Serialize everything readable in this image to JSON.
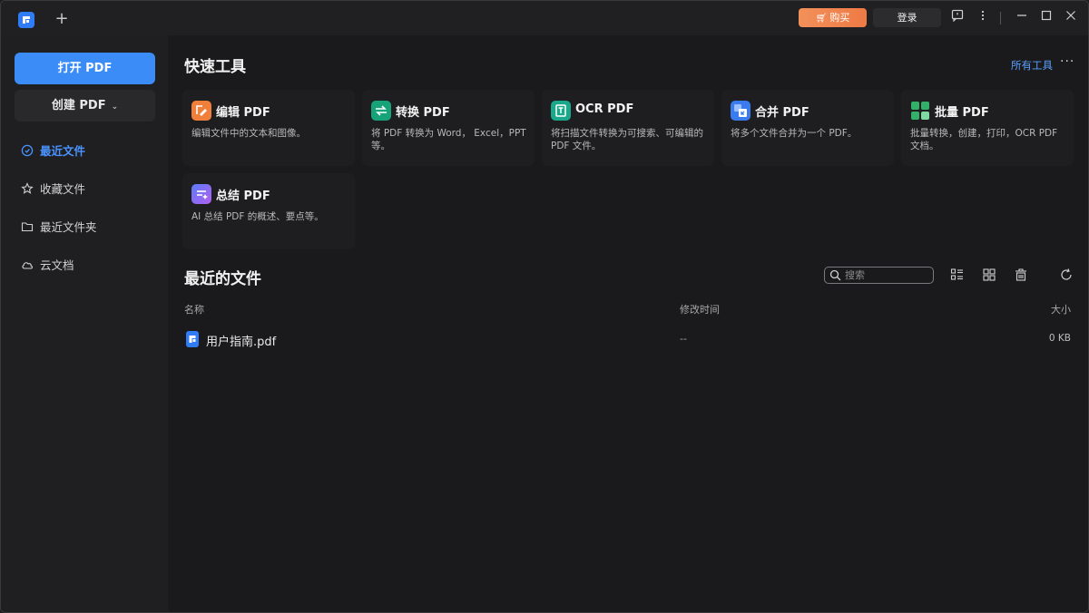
{
  "titlebar": {
    "new_tab": "+",
    "buy_label": "购买",
    "login_label": "登录",
    "icons": [
      "feedback-icon",
      "more-vertical-icon",
      "minimize-icon",
      "maximize-icon",
      "close-icon"
    ]
  },
  "sidebar": {
    "open_pdf": "打开 PDF",
    "create_pdf": "创建 PDF",
    "items": [
      {
        "label": "最近文件",
        "icon": "clock-icon",
        "active": true
      },
      {
        "label": "收藏文件",
        "icon": "star-icon",
        "active": false
      },
      {
        "label": "最近文件夹",
        "icon": "folder-icon",
        "active": false
      },
      {
        "label": "云文档",
        "icon": "cloud-icon",
        "active": false
      }
    ]
  },
  "quick_tools": {
    "title": "快速工具",
    "all_tools": "所有工具",
    "more": "···",
    "tools": [
      {
        "name": "编辑 PDF",
        "desc": "编辑文件中的文本和图像。",
        "color": "#f07f3c"
      },
      {
        "name": "转换 PDF",
        "desc": "将 PDF 转换为 Word， Excel，PPT 等。",
        "color": "#17a37a"
      },
      {
        "name": "OCR PDF",
        "desc": "将扫描文件转换为可搜索、可编辑的 PDF 文件。",
        "color": "#1aa78a"
      },
      {
        "name": "合并 PDF",
        "desc": "将多个文件合并为一个 PDF。",
        "color": "#3b7bf0"
      },
      {
        "name": "批量 PDF",
        "desc": "批量转换，创建，打印，OCR PDF 文档。",
        "color": "#32b06a"
      },
      {
        "name": "总结 PDF",
        "desc": "AI 总结 PDF 的概述、要点等。",
        "color": "#7a5cf0"
      }
    ]
  },
  "recent": {
    "title": "最近的文件",
    "search_placeholder": "搜索",
    "columns": {
      "name": "名称",
      "modified": "修改时间",
      "size": "大小"
    },
    "files": [
      {
        "name": "用户指南.pdf",
        "modified": "--",
        "size": "0 KB"
      }
    ]
  },
  "colors": {
    "accent": "#3b8cf7",
    "buy": "#ef7a45"
  }
}
